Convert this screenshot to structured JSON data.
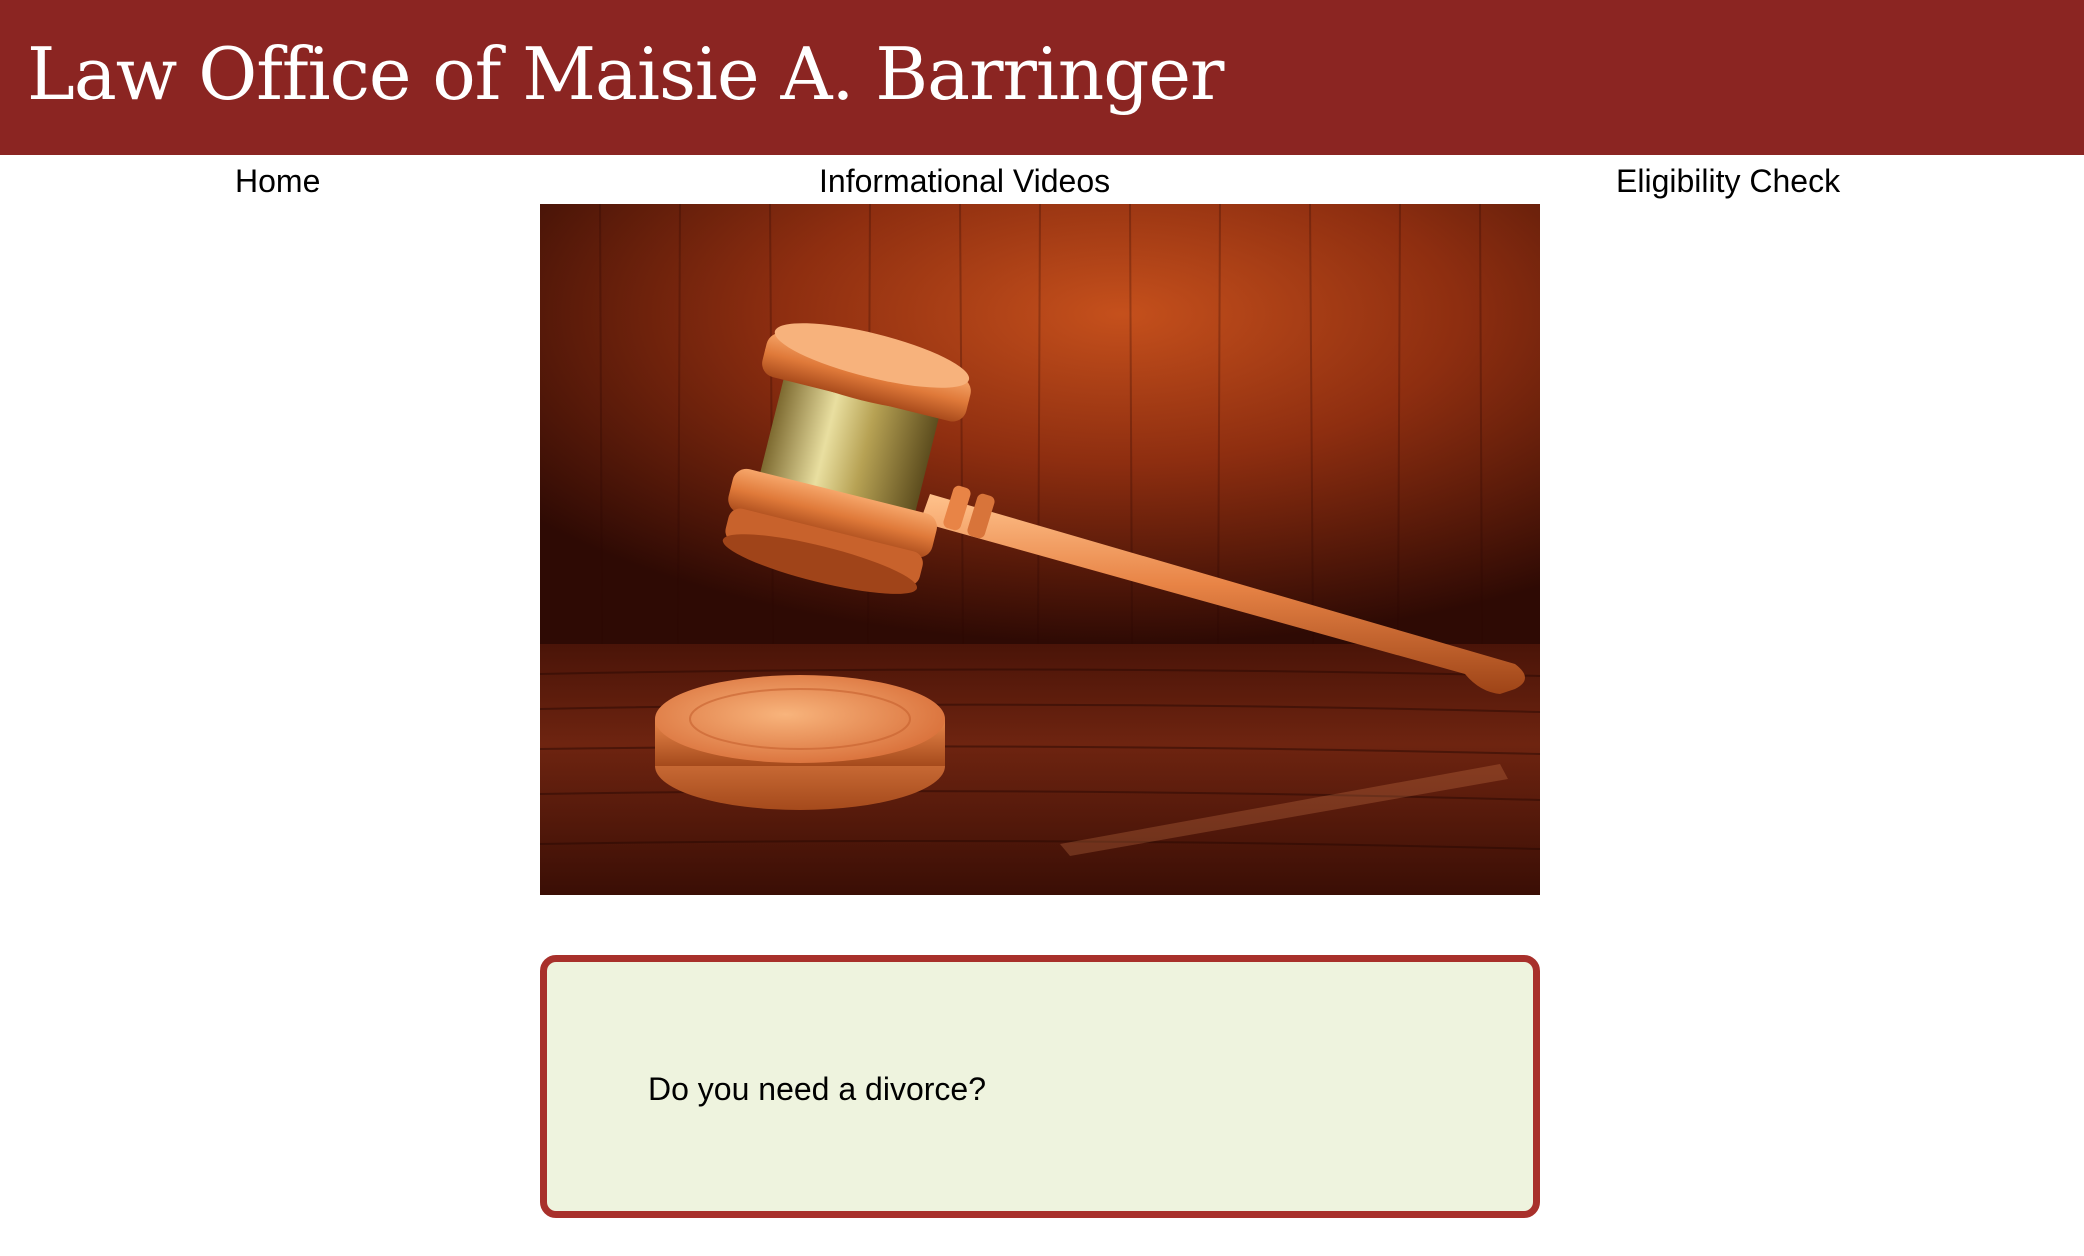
{
  "header": {
    "title": "Law Office of Maisie A. Barringer",
    "background_color": "#8b2522"
  },
  "nav": {
    "items": [
      {
        "label": "Home"
      },
      {
        "label": "Informational Videos"
      },
      {
        "label": "Eligibility Check"
      }
    ]
  },
  "hero": {
    "image_subject": "gavel-on-sound-block"
  },
  "cta": {
    "text": "Do you need a divorce?",
    "background_color": "#eef3de",
    "border_color": "#a8302b"
  }
}
